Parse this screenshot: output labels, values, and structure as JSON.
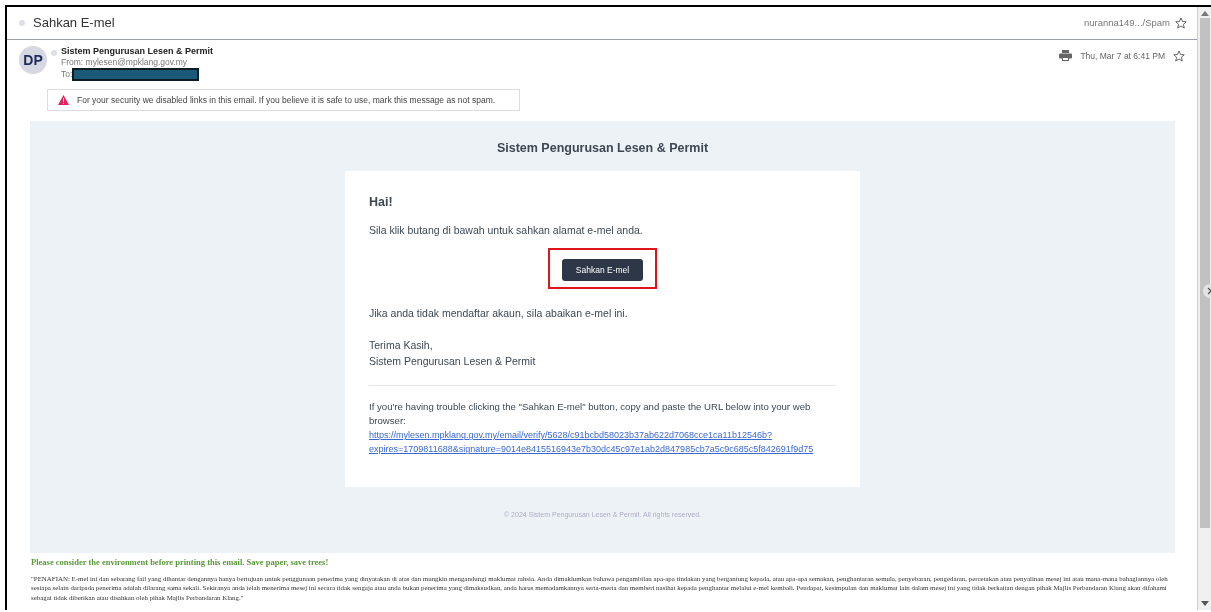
{
  "header": {
    "title": "Sahkan E-mel",
    "folder": "nuranna149.../Spam",
    "starred": false
  },
  "message": {
    "avatar": "DP",
    "sender": "Sistem Pengurusan Lesen & Permit",
    "from": "From: mylesen@mpklang.gov.my",
    "to_label": "To:",
    "date": "Thu, Mar 7 at 6:41 PM",
    "starred": false,
    "warning": "For your security we disabled links in this email. If you believe it is safe to use, mark this message as not spam."
  },
  "email": {
    "heading": "Sistem Pengurusan Lesen & Permit",
    "greeting": "Hai!",
    "intro": "Sila klik butang di bawah untuk sahkan alamat e-mel anda.",
    "button": {
      "label": "Sahkan E-mel",
      "highlighted": true
    },
    "ignore_note": "Jika anda tidak mendaftar akaun, sila abaikan e-mel ini.",
    "closing": [
      "Terima Kasih,",
      "Sistem Pengurusan Lesen & Permit"
    ],
    "fallback_text": "If you're having trouble clicking the \"Sahkan E-mel\" button, copy and paste the URL below into your web browser:",
    "url": "https://mylesen.mpklang.gov.my/email/verify/5628/c91bcbd58023b37ab622d7068cce1ca11b12546b?expires=1709811688&signature=9014e8415516943e7b30dc45c97e1ab2d847985cb7a5c9c685c5f842691f9d75",
    "copyright": "© 2024 Sistem Pengurusan Lesen & Permit. All rights reserved."
  },
  "footer": {
    "eco_note": "Please consider the environment before printing this email. Save paper, save trees!",
    "disclaimer": "\"PENAFIAN: E-mel ini dan sebarang fail yang dihantar dengannya hanya bertujuan untuk penggunaan penerima yang dinyatakan di atas dan mungkin mengandungi maklumat rahsia. Anda dimaklumkan bahawa pengambilan apa-apa tindakan yang bergantung kepada, atau apa-apa semakan, penghantaran semula, penyebaran, pengedaran, percetakan atau penyalinan mesej ini atau mana-mana bahagiannya oleh sesiapa selain daripada penerima adalah dilarang sama sekali. Sekiranya anda telah menerima mesej ini secara tidak sengaja atau anda bukan penerima yang dimaksudkan, anda harus memadamkannya serta-merta dan memberi nasihat kepada penghantar melalui e-mel kembali. Pendapat, kesimpulan dan maklumat lain dalam mesej ini yang tidak berkaitan dengan pihak Majlis Perbandaran Klang akan difahami sebagai tidak diberikan atau disahkan oleh pihak Majlis Perbandaran Klang.\""
  }
}
